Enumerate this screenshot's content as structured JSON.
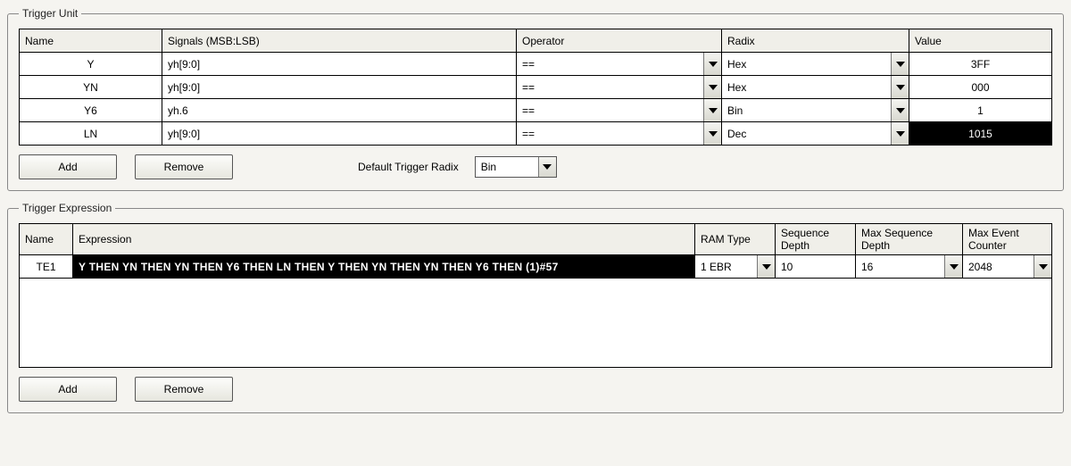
{
  "trigger_unit": {
    "legend": "Trigger Unit",
    "headers": {
      "name": "Name",
      "signals": "Signals (MSB:LSB)",
      "operator": "Operator",
      "radix": "Radix",
      "value": "Value"
    },
    "rows": [
      {
        "name": "Y",
        "signals": "yh[9:0]",
        "operator": "==",
        "radix": "Hex",
        "value": "3FF",
        "value_inverted": false
      },
      {
        "name": "YN",
        "signals": "yh[9:0]",
        "operator": "==",
        "radix": "Hex",
        "value": "000",
        "value_inverted": false
      },
      {
        "name": "Y6",
        "signals": "yh.6",
        "operator": "==",
        "radix": "Bin",
        "value": "1",
        "value_inverted": false
      },
      {
        "name": "LN",
        "signals": "yh[9:0]",
        "operator": "==",
        "radix": "Dec",
        "value": "1015",
        "value_inverted": true
      }
    ],
    "buttons": {
      "add": "Add",
      "remove": "Remove"
    },
    "default_radix_label": "Default Trigger Radix",
    "default_radix_value": "Bin"
  },
  "trigger_expression": {
    "legend": "Trigger Expression",
    "headers": {
      "name": "Name",
      "expression": "Expression",
      "ram_type": "RAM Type",
      "seq_depth": "Sequence Depth",
      "max_seq_depth": "Max Sequence Depth",
      "max_event_counter": "Max Event Counter"
    },
    "rows": [
      {
        "name": "TE1",
        "expression": "Y THEN YN THEN YN THEN Y6 THEN LN THEN Y THEN YN THEN YN THEN Y6 THEN (1)#57",
        "ram_type": "1 EBR",
        "seq_depth": "10",
        "max_seq_depth": "16",
        "max_event_counter": "2048"
      }
    ],
    "buttons": {
      "add": "Add",
      "remove": "Remove"
    }
  },
  "chart_data": {
    "type": "table",
    "title": "Trigger Unit",
    "columns": [
      "Name",
      "Signals (MSB:LSB)",
      "Operator",
      "Radix",
      "Value"
    ],
    "rows": [
      [
        "Y",
        "yh[9:0]",
        "==",
        "Hex",
        "3FF"
      ],
      [
        "YN",
        "yh[9:0]",
        "==",
        "Hex",
        "000"
      ],
      [
        "Y6",
        "yh.6",
        "==",
        "Bin",
        "1"
      ],
      [
        "LN",
        "yh[9:0]",
        "==",
        "Dec",
        "1015"
      ]
    ]
  }
}
